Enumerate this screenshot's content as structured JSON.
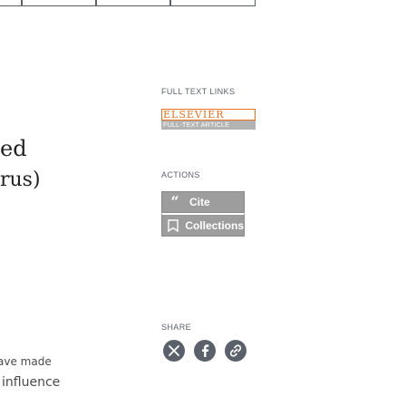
{
  "article": {
    "fragment_1": "ed",
    "fragment_2": "rus)",
    "fragment_3": "ave made",
    "fragment_4": "influence"
  },
  "full_text_links": {
    "heading": "FULL TEXT LINKS",
    "elsevier_top": "ELSEVIER",
    "elsevier_bottom": "FULL-TEXT ARTICLE"
  },
  "actions": {
    "heading": "ACTIONS",
    "cite_label": "Cite",
    "collections_label": "Collections"
  },
  "share": {
    "heading": "SHARE",
    "icons": [
      "twitter-x-icon",
      "facebook-icon",
      "permalink-icon"
    ]
  },
  "colors": {
    "button_bg": "#9d9d9d",
    "elsevier_orange": "#e9711c",
    "share_icon_bg": "#5b616b"
  }
}
